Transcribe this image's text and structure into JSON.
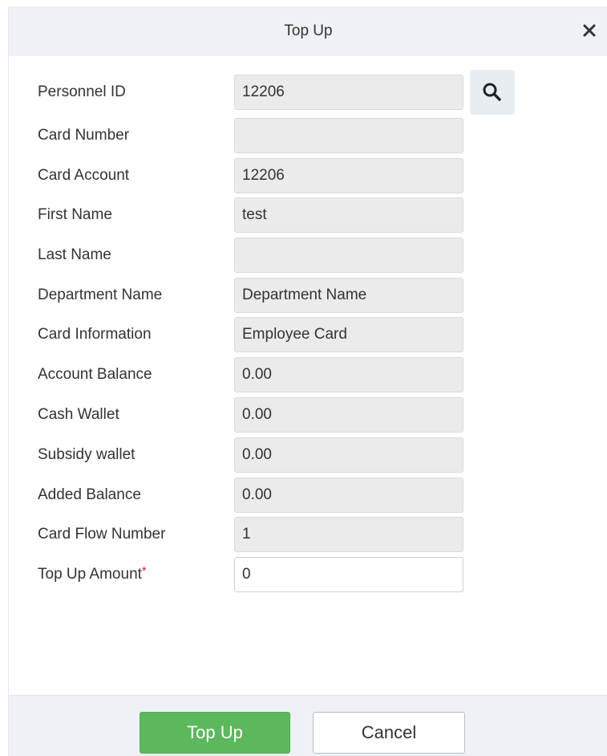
{
  "dialog": {
    "title": "Top Up"
  },
  "form": {
    "fields": [
      {
        "label": "Personnel ID",
        "value": "12206",
        "editable": false
      },
      {
        "label": "Card Number",
        "value": "",
        "editable": false
      },
      {
        "label": "Card Account",
        "value": "12206",
        "editable": false
      },
      {
        "label": "First Name",
        "value": "test",
        "editable": false
      },
      {
        "label": "Last Name",
        "value": "",
        "editable": false
      },
      {
        "label": "Department Name",
        "value": "Department Name",
        "editable": false
      },
      {
        "label": "Card Information",
        "value": "Employee Card",
        "editable": false
      },
      {
        "label": "Account Balance",
        "value": "0.00",
        "editable": false
      },
      {
        "label": "Cash Wallet",
        "value": "0.00",
        "editable": false
      },
      {
        "label": "Subsidy wallet",
        "value": "0.00",
        "editable": false
      },
      {
        "label": "Added Balance",
        "value": "0.00",
        "editable": false
      },
      {
        "label": "Card Flow Number",
        "value": "1",
        "editable": false
      },
      {
        "label": "Top Up Amount",
        "value": "0",
        "editable": true,
        "required_mark": "*"
      }
    ]
  },
  "buttons": {
    "confirm_label": "Top Up",
    "cancel_label": "Cancel"
  },
  "icons": {
    "close": "close-icon",
    "search": "search-icon"
  },
  "colors": {
    "titlebar_bg": "#eef1f5",
    "readonly_field_bg": "#ebebeb",
    "primary_button": "#5cb85c",
    "required_star": "#e02020"
  }
}
